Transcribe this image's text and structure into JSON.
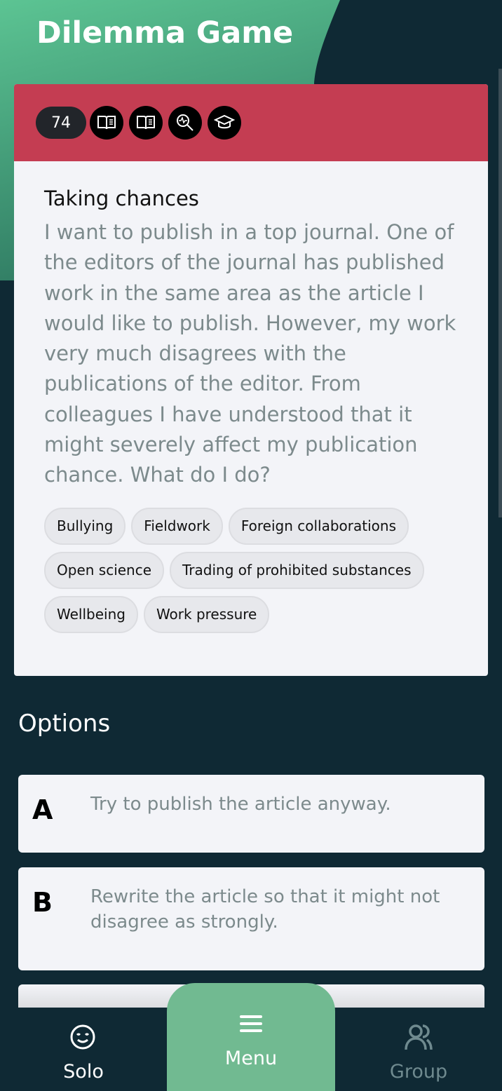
{
  "app": {
    "title": "Dilemma Game"
  },
  "dilemma": {
    "number": "74",
    "icons": [
      "book-icon",
      "book-icon",
      "data-search-icon",
      "graduation-cap-icon"
    ],
    "header_color": "#c43d52",
    "title": "Taking chances",
    "text": "I want to publish in a top journal. One of the editors of the journal has published work in the same area as the article I would like to publish. However, my work very much disagrees with the publications of the editor. From colleagues I have understood that it might severely affect my publication chance. What do I do?",
    "tags": [
      "Bullying",
      "Fieldwork",
      "Foreign collaborations",
      "Open science",
      "Trading of prohibited substances",
      "Wellbeing",
      "Work pressure"
    ]
  },
  "options": {
    "heading": "Options",
    "items": [
      {
        "letter": "A",
        "text": "Try to publish the article anyway."
      },
      {
        "letter": "B",
        "text": "Rewrite the article so that it might not disagree as strongly."
      }
    ]
  },
  "nav": {
    "solo": "Solo",
    "menu": "Menu",
    "group": "Group",
    "accent": "#71ba91"
  }
}
